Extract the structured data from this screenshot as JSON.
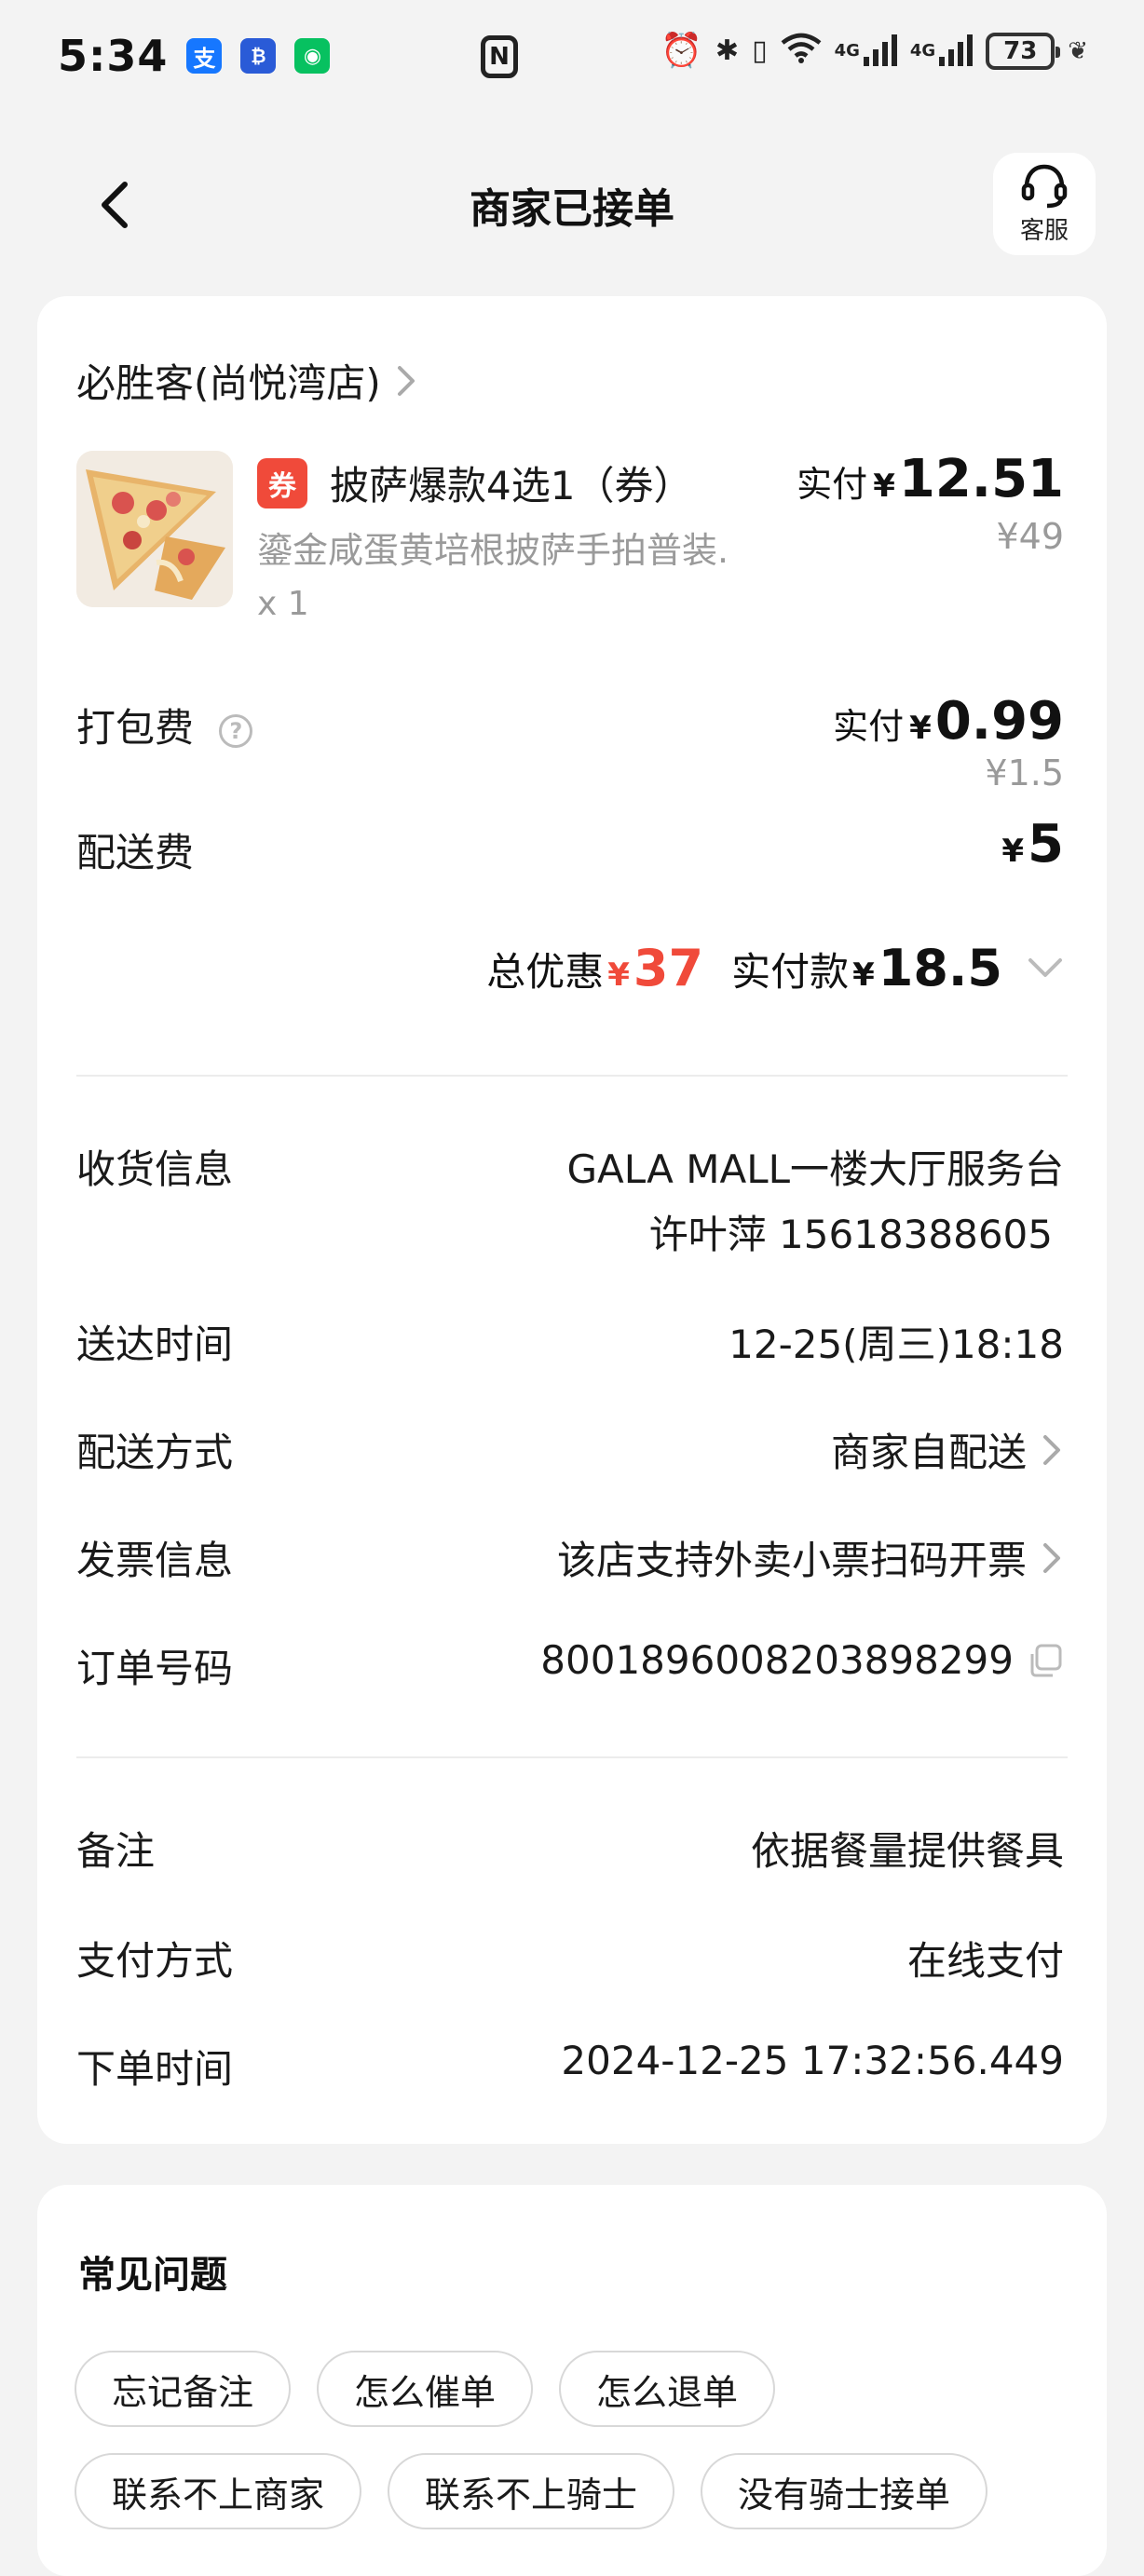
{
  "status_bar": {
    "time": "5:34",
    "apps": [
      {
        "name": "alipay",
        "glyph": "支",
        "color": "#1677ff"
      },
      {
        "name": "bank",
        "glyph": "₿",
        "color": "#2a5bd7"
      },
      {
        "name": "wechat",
        "glyph": "◉",
        "color": "#07c160"
      }
    ],
    "nfc": "N",
    "network_1": "4G",
    "network_2": "4G",
    "battery": "73"
  },
  "header": {
    "title": "商家已接单",
    "service_label": "客服"
  },
  "order": {
    "store_name": "必胜客(尚悦湾店)",
    "product": {
      "tag": "券",
      "name": "披萨爆款4选1（券）",
      "description": "鎏金咸蛋黄培根披萨手拍普装.",
      "quantity": "x 1",
      "paid_label": "实付",
      "currency": "¥",
      "paid_amount": "12.51",
      "original_price": "¥49"
    },
    "packing_fee": {
      "label": "打包费",
      "help": "?",
      "paid_label": "实付",
      "currency": "¥",
      "paid_amount": "0.99",
      "original_price": "¥1.5"
    },
    "delivery_fee": {
      "label": "配送费",
      "currency": "¥",
      "amount": "5"
    },
    "summary": {
      "discount_label": "总优惠",
      "currency": "¥",
      "discount_amount": "37",
      "paid_label": "实付款",
      "paid_amount": "18.5"
    },
    "info": {
      "address_label": "收货信息",
      "address": "GALA MALL一楼大厅服务台",
      "contact": "许叶萍 15618388605",
      "delivery_time_label": "送达时间",
      "delivery_time": "12-25(周三)18:18",
      "delivery_method_label": "配送方式",
      "delivery_method": "商家自配送",
      "invoice_label": "发票信息",
      "invoice": "该店支持外卖小票扫码开票",
      "order_no_label": "订单号码",
      "order_no": "8001896008203898299"
    },
    "extra": {
      "note_label": "备注",
      "note": "依据餐量提供餐具",
      "payment_label": "支付方式",
      "payment": "在线支付",
      "order_time_label": "下单时间",
      "order_time": "2024-12-25 17:32:56.449"
    }
  },
  "faq": {
    "title": "常见问题",
    "chips": [
      "忘记备注",
      "怎么催单",
      "怎么退单",
      "联系不上商家",
      "联系不上骑士",
      "没有骑士接单"
    ]
  },
  "colors": {
    "accent_red": "#f04a3a",
    "muted_text": "#9a9a9a",
    "background": "#f3f3f3"
  }
}
